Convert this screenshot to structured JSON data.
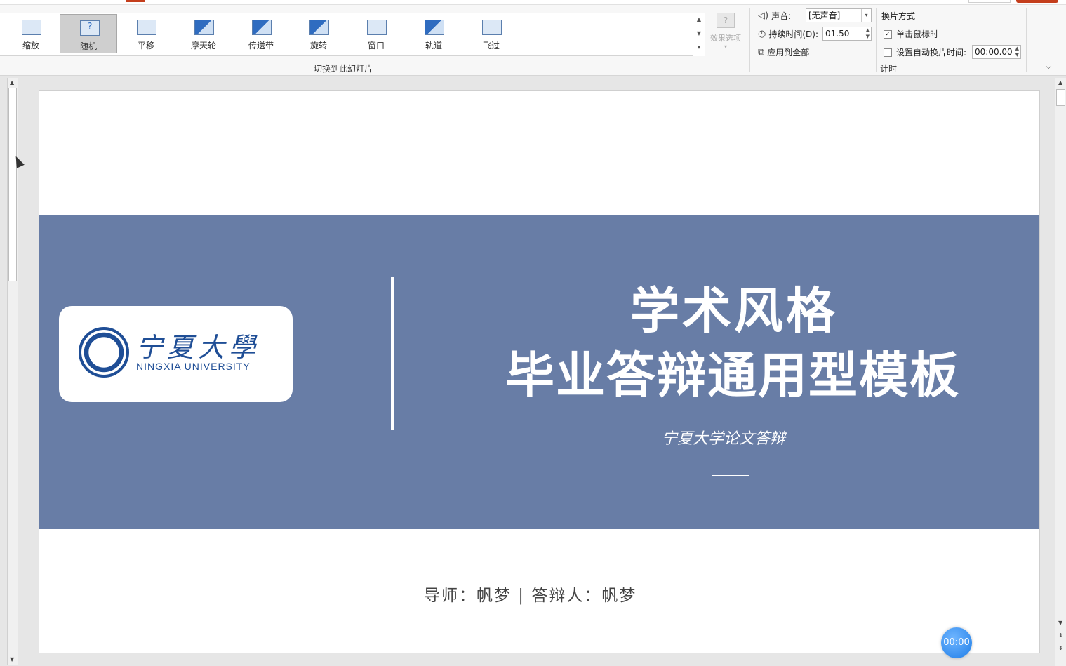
{
  "ribbon": {
    "gallery_items": [
      {
        "label": "缩放",
        "selected": false,
        "icon": "zoom-transition-icon"
      },
      {
        "label": "随机",
        "selected": true,
        "icon": "random-transition-icon"
      },
      {
        "label": "平移",
        "selected": false,
        "icon": "pan-transition-icon"
      },
      {
        "label": "摩天轮",
        "selected": false,
        "icon": "ferris-wheel-transition-icon"
      },
      {
        "label": "传送带",
        "selected": false,
        "icon": "conveyor-transition-icon"
      },
      {
        "label": "旋转",
        "selected": false,
        "icon": "rotate-transition-icon"
      },
      {
        "label": "窗口",
        "selected": false,
        "icon": "window-transition-icon"
      },
      {
        "label": "轨道",
        "selected": false,
        "icon": "orbit-transition-icon"
      },
      {
        "label": "飞过",
        "selected": false,
        "icon": "fly-through-transition-icon"
      }
    ],
    "transition_group_label": "切换到此幻灯片",
    "effect_options_label": "效果选项",
    "sound_label": "声音:",
    "sound_value": "[无声音]",
    "duration_label": "持续时间(D):",
    "duration_value": "01.50",
    "apply_all_label": "应用到全部",
    "advance_label": "换片方式",
    "on_click_label": "单击鼠标时",
    "on_click_checked": true,
    "auto_after_label": "设置自动换片时间:",
    "auto_after_checked": false,
    "auto_after_value": "00:00.00",
    "timing_group_label": "计时"
  },
  "slide": {
    "logo_cn": "宁夏大學",
    "logo_en": "NINGXIA UNIVERSITY",
    "title_line1": "学术风格",
    "title_line2": "毕业答辩通用型模板",
    "subtitle": "宁夏大学论文答辩",
    "advisor_line": "导师：帆梦 | 答辩人：帆梦",
    "band_color": "#687da6"
  },
  "timer": {
    "value": "00:00"
  }
}
